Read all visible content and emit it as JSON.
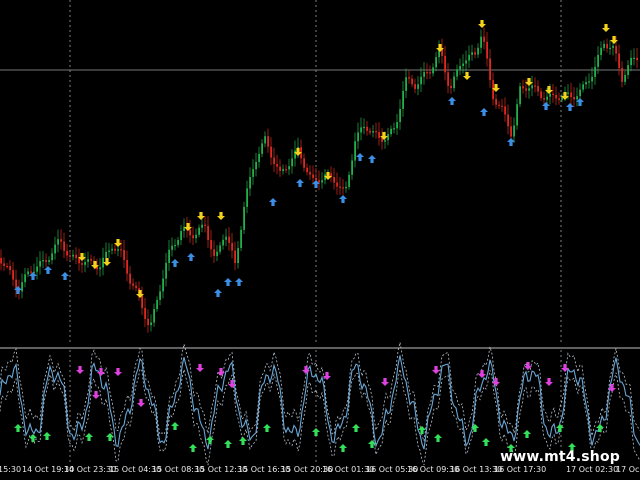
{
  "chart": {
    "colors": {
      "background": "#000000",
      "bull_candle": "#22b24c",
      "bear_candle": "#e0291f",
      "grid": "#c8c8c8",
      "up_arrow": "#3b8fe6",
      "down_arrow": "#f2d21b",
      "osc_line": "#6aa8d8",
      "osc_band": "#b9c4cf",
      "osc_up_arrow": "#33e05a",
      "osc_down_arrow": "#e040e0",
      "separator": "#9a9a9a"
    },
    "icons": {
      "buy_signal": "blue-up-arrow-icon",
      "sell_signal": "yellow-down-arrow-icon",
      "osc_buy_signal": "green-up-arrow-icon",
      "osc_sell_signal": "magenta-down-arrow-icon"
    }
  },
  "time_axis": {
    "labels": [
      "15:30",
      "14 Oct 19:30",
      "14 Oct 23:30",
      "15 Oct 04:30",
      "15 Oct 08:30",
      "15 Oct 12:30",
      "15 Oct 16:30",
      "15 Oct 20:30",
      "16 Oct 01:30",
      "16 Oct 05:30",
      "16 Oct 09:30",
      "16 Oct 13:30",
      "16 Oct 17:30",
      "17 Oct 02:30",
      "17 Oc"
    ]
  },
  "watermark": {
    "text": "www.mt4.shop"
  }
}
